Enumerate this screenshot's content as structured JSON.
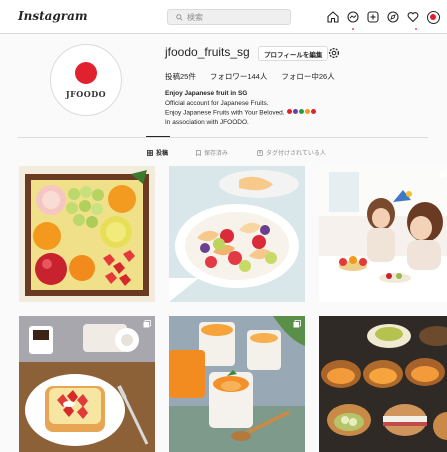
{
  "header": {
    "logo": "Instagram",
    "search_placeholder": "検索",
    "icons": [
      "home-icon",
      "messenger-icon",
      "new-post-icon",
      "explore-icon",
      "activity-heart-icon",
      "profile-avatar-icon"
    ]
  },
  "profile": {
    "username": "jfoodo_fruits_sg",
    "edit_button": "プロフィールを編集",
    "avatar_text": "JFOODO",
    "stats": {
      "posts": "投稿25件",
      "followers": "フォロワー144人",
      "following": "フォロー中26人"
    },
    "bio": {
      "name": "Enjoy Japanese fruit in SG",
      "lines": [
        "Official account for Japanese Fruits.",
        "Enjoy Japanese Fruits with Your Beloved.",
        "In association with JFOODO."
      ]
    }
  },
  "tabs": [
    {
      "label": "投稿",
      "active": true
    },
    {
      "label": "保存済み",
      "active": false
    },
    {
      "label": "タグ付けされている人",
      "active": false
    }
  ],
  "colors": {
    "accent_red": "#e0222e",
    "border": "#dbdbdb",
    "text": "#262626",
    "muted": "#8e8e8e"
  },
  "posts": [
    {
      "name": "fruit-gift-box"
    },
    {
      "name": "fruit-salad-plate"
    },
    {
      "name": "family-birthday-party"
    },
    {
      "name": "strawberry-toast"
    },
    {
      "name": "peach-jelly-cups"
    },
    {
      "name": "dorayaki-desserts"
    }
  ]
}
